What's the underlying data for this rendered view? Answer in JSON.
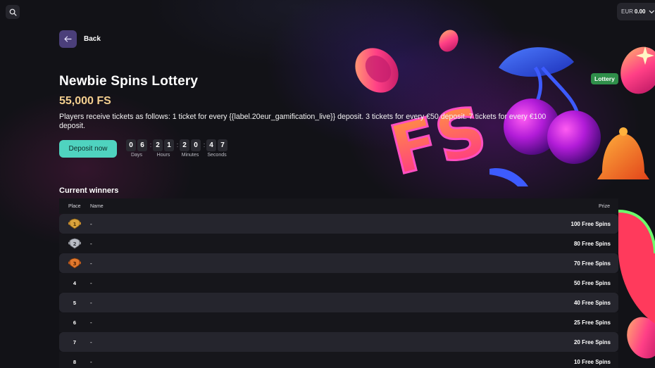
{
  "header": {
    "currency_code": "EUR",
    "balance": "0.00"
  },
  "back_label": "Back",
  "badge": "Lottery",
  "lottery": {
    "title": "Newbie Spins Lottery",
    "total_prize": "55,000 FS",
    "description": "Players receive tickets as follows: 1 ticket for every {{label.20eur_gamification_live}} deposit. 3 tickets for every €50 deposit. 7 tickets for every €100 deposit.",
    "deposit_label": "Deposit now"
  },
  "countdown": {
    "days": [
      "0",
      "6"
    ],
    "hours": [
      "2",
      "1"
    ],
    "minutes": [
      "2",
      "0"
    ],
    "seconds": [
      "4",
      "7"
    ],
    "separator": ":",
    "labels": {
      "days": "Days",
      "hours": "Hours",
      "minutes": "Minutes",
      "seconds": "Seconds"
    }
  },
  "winners": {
    "title": "Current winners",
    "columns": {
      "place": "Place",
      "name": "Name",
      "prize": "Prize"
    },
    "rows": [
      {
        "place": "1",
        "name": "-",
        "prize": "100 Free Spins",
        "medal": "gold"
      },
      {
        "place": "2",
        "name": "-",
        "prize": "80 Free Spins",
        "medal": "silver"
      },
      {
        "place": "3",
        "name": "-",
        "prize": "70 Free Spins",
        "medal": "bronze"
      },
      {
        "place": "4",
        "name": "-",
        "prize": "50 Free Spins"
      },
      {
        "place": "5",
        "name": "-",
        "prize": "40 Free Spins"
      },
      {
        "place": "6",
        "name": "-",
        "prize": "25 Free Spins"
      },
      {
        "place": "7",
        "name": "-",
        "prize": "20 Free Spins"
      },
      {
        "place": "8",
        "name": "-",
        "prize": "10 Free Spins"
      }
    ]
  },
  "colors": {
    "accent": "#4fd3bf",
    "gold_text": "#f4cf8f",
    "badge_green": "#2f8f4a",
    "back_button": "#4b3f7a"
  },
  "icons": {
    "search": "search-icon",
    "chevron": "chevron-down-icon",
    "back": "arrow-left-icon"
  }
}
